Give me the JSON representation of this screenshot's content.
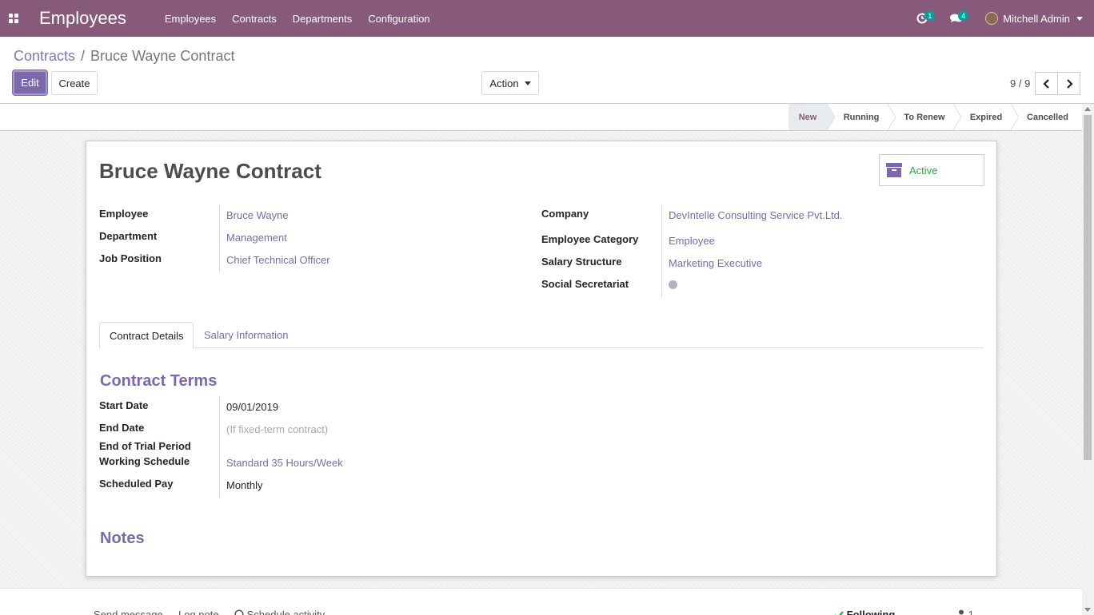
{
  "navbar": {
    "app_title": "Employees",
    "menu": [
      "Employees",
      "Contracts",
      "Departments",
      "Configuration"
    ],
    "activity_count": "1",
    "message_count": "4",
    "user_name": "Mitchell Admin"
  },
  "breadcrumb": {
    "parent": "Contracts",
    "separator": "/",
    "current": "Bruce Wayne Contract"
  },
  "buttons": {
    "edit": "Edit",
    "create": "Create",
    "action": "Action"
  },
  "pager": {
    "value": "9 / 9"
  },
  "stages": {
    "items": [
      "New",
      "Running",
      "To Renew",
      "Expired",
      "Cancelled"
    ],
    "current": "New"
  },
  "record": {
    "title": "Bruce Wayne Contract",
    "active_label": "Active",
    "left_fields": [
      {
        "label": "Employee",
        "value": "Bruce Wayne"
      },
      {
        "label": "Department",
        "value": "Management"
      },
      {
        "label": "Job Position",
        "value": "Chief Technical Officer"
      }
    ],
    "right_fields": [
      {
        "label": "Company",
        "value": "DevIntelle Consulting Service Pvt.Ltd."
      },
      {
        "label": "Employee Category",
        "value": "Employee"
      },
      {
        "label": "Salary Structure",
        "value": "Marketing Executive"
      },
      {
        "label": "Social Secretariat",
        "value": ""
      }
    ]
  },
  "tabs": [
    "Contract Details",
    "Salary Information"
  ],
  "contract_terms": {
    "title": "Contract Terms",
    "fields": [
      {
        "label": "Start Date",
        "value": "09/01/2019"
      },
      {
        "label": "End Date",
        "placeholder": "(If fixed-term contract)"
      },
      {
        "label": "End of Trial Period",
        "value": ""
      },
      {
        "label": "Working Schedule",
        "value": "Standard 35 Hours/Week"
      },
      {
        "label": "Scheduled Pay",
        "value": "Monthly"
      }
    ]
  },
  "notes": {
    "title": "Notes"
  },
  "chatter": {
    "send_message": "Send message",
    "log_note": "Log note",
    "schedule_activity": "Schedule activity",
    "following": "Following",
    "followers": "1"
  },
  "colors": {
    "navbar": "#875a7b",
    "accent": "#7c6aa8",
    "active_status": "#28a745"
  }
}
